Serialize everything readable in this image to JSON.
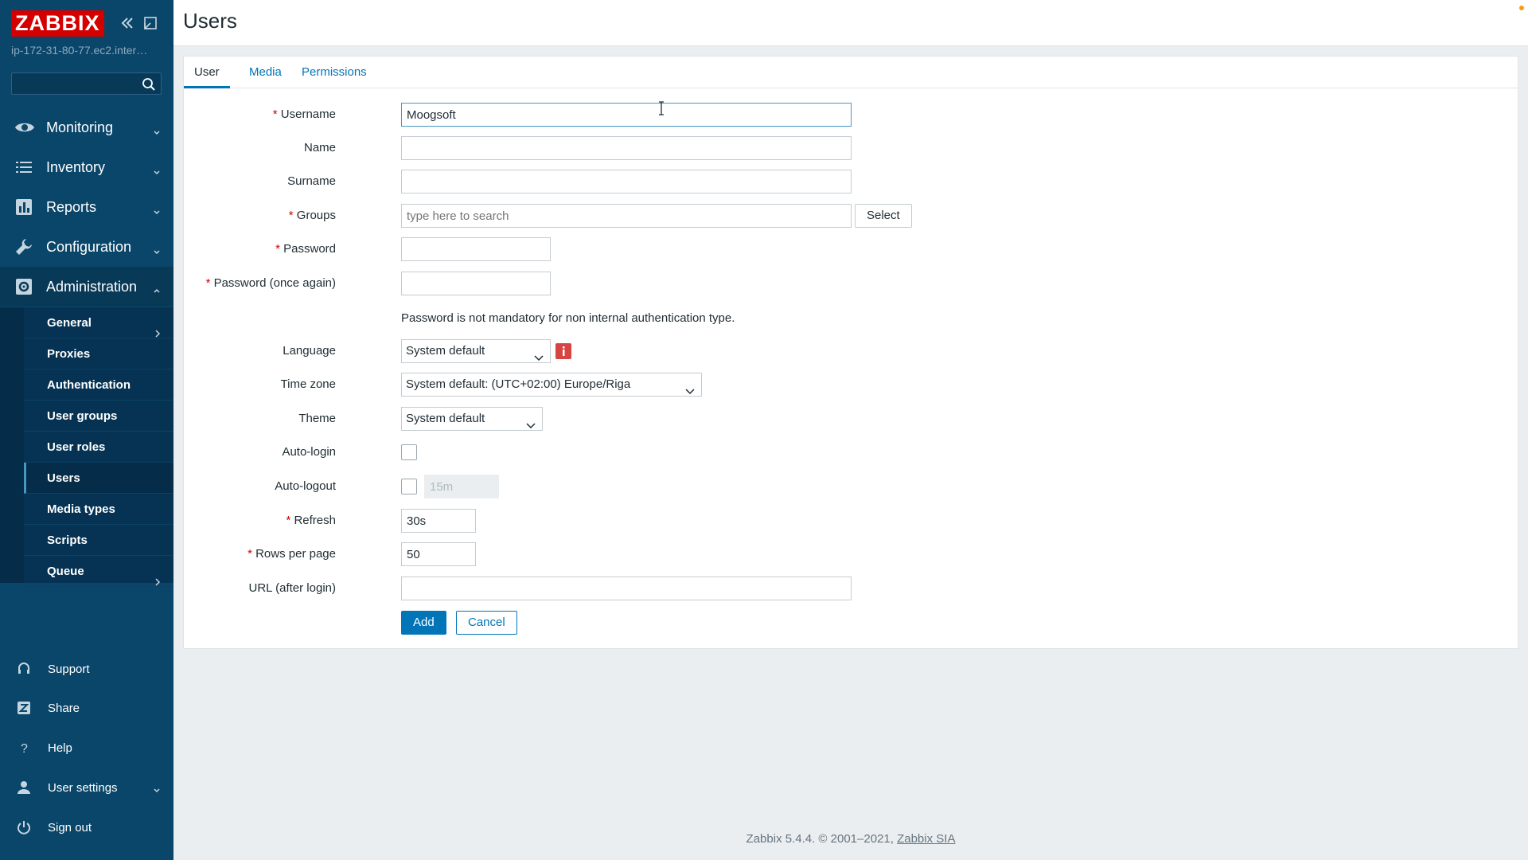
{
  "app": {
    "logo": "ZABBIX",
    "server": "ip-172-31-80-77.ec2.inter…",
    "search_placeholder": ""
  },
  "nav": {
    "monitoring": "Monitoring",
    "inventory": "Inventory",
    "reports": "Reports",
    "configuration": "Configuration",
    "administration": "Administration"
  },
  "admin_submenu": [
    "General",
    "Proxies",
    "Authentication",
    "User groups",
    "User roles",
    "Users",
    "Media types",
    "Scripts",
    "Queue"
  ],
  "bottom_nav": {
    "support": "Support",
    "share": "Share",
    "help": "Help",
    "user_settings": "User settings",
    "sign_out": "Sign out"
  },
  "page": {
    "title": "Users"
  },
  "tabs": [
    "User",
    "Media",
    "Permissions"
  ],
  "form": {
    "username": {
      "label": "Username",
      "value": "Moogsoft"
    },
    "name": {
      "label": "Name",
      "value": ""
    },
    "surname": {
      "label": "Surname",
      "value": ""
    },
    "groups": {
      "label": "Groups",
      "placeholder": "type here to search",
      "select_button": "Select"
    },
    "password": {
      "label": "Password",
      "value": ""
    },
    "password_again": {
      "label": "Password (once again)",
      "value": ""
    },
    "password_note": "Password is not mandatory for non internal authentication type.",
    "language": {
      "label": "Language",
      "value": "System default"
    },
    "timezone": {
      "label": "Time zone",
      "value": "System default: (UTC+02:00) Europe/Riga"
    },
    "theme": {
      "label": "Theme",
      "value": "System default"
    },
    "autologin": {
      "label": "Auto-login",
      "checked": false
    },
    "autologout": {
      "label": "Auto-logout",
      "checked": false,
      "value": "15m"
    },
    "refresh": {
      "label": "Refresh",
      "value": "30s"
    },
    "rows_per_page": {
      "label": "Rows per page",
      "value": "50"
    },
    "url": {
      "label": "URL (after login)",
      "value": ""
    },
    "required_marker": "*",
    "add_button": "Add",
    "cancel_button": "Cancel"
  },
  "footer": {
    "text": "Zabbix 5.4.4. © 2001–2021, ",
    "link": "Zabbix SIA"
  },
  "colors": {
    "sidebar": "#0a466a",
    "accent": "#0275b8",
    "logo": "#d40000"
  }
}
